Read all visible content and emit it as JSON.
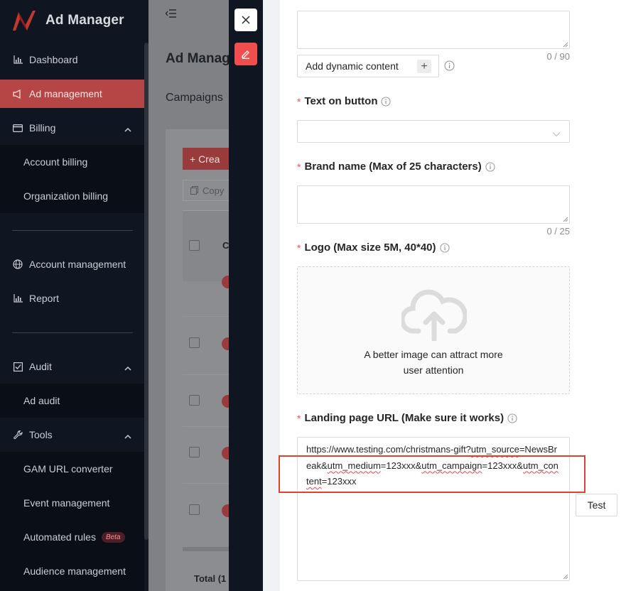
{
  "app": {
    "title": "Ad Manager"
  },
  "sidebar": {
    "items": [
      {
        "label": "Dashboard",
        "icon": "bar-chart-icon"
      },
      {
        "label": "Ad management",
        "icon": "notification-icon",
        "active": true
      },
      {
        "label": "Billing",
        "icon": "credit-card-icon"
      },
      {
        "label": "Account billing"
      },
      {
        "label": "Organization billing"
      },
      {
        "label": "Account management",
        "icon": "globe-icon"
      },
      {
        "label": "Report",
        "icon": "bar-chart-icon"
      },
      {
        "label": "Audit",
        "icon": "check-square-icon"
      },
      {
        "label": "Ad audit"
      },
      {
        "label": "Tools",
        "icon": "wrench-icon"
      },
      {
        "label": "GAM URL converter"
      },
      {
        "label": "Event management"
      },
      {
        "label": "Automated rules",
        "badge": "Beta"
      },
      {
        "label": "Audience management"
      }
    ]
  },
  "main": {
    "page_title": "Ad Manag",
    "tab": "Campaigns",
    "create_label": "+ Crea",
    "copy_label": "Copy",
    "column_initial": "C",
    "total_label": "Total (1"
  },
  "drawer": {
    "top_counter": "0 / 90",
    "dynamic_content_label": "Add dynamic content",
    "dynamic_plus": "+",
    "text_on_button": {
      "label": "Text on button"
    },
    "brand_name": {
      "label": "Brand name (Max of 25 characters)",
      "counter": "0 / 25"
    },
    "logo": {
      "label": "Logo (Max size 5M, 40*40)",
      "hint_line1": "A better image can attract more",
      "hint_line2": "user attention"
    },
    "landing_url": {
      "label": "Landing page URL (Make sure it works)",
      "value_part1": "https://www.testing.com/christmans-gift?",
      "value_part2": "utm_source",
      "value_part3": "=NewsBreak&",
      "value_part4": "utm_medium",
      "value_part5": "=123xxx&",
      "value_part6": "utm_campaign",
      "value_part7": "=123xxx&",
      "value_part8": "utm_content",
      "value_part9": "=123xxx"
    },
    "test_label": "Test",
    "required_mark": "*"
  },
  "colors": {
    "accent": "#ef4e4e",
    "sidebar_bg": "#0f1622",
    "active_item": "#b64545",
    "highlight": "#e0412f"
  }
}
